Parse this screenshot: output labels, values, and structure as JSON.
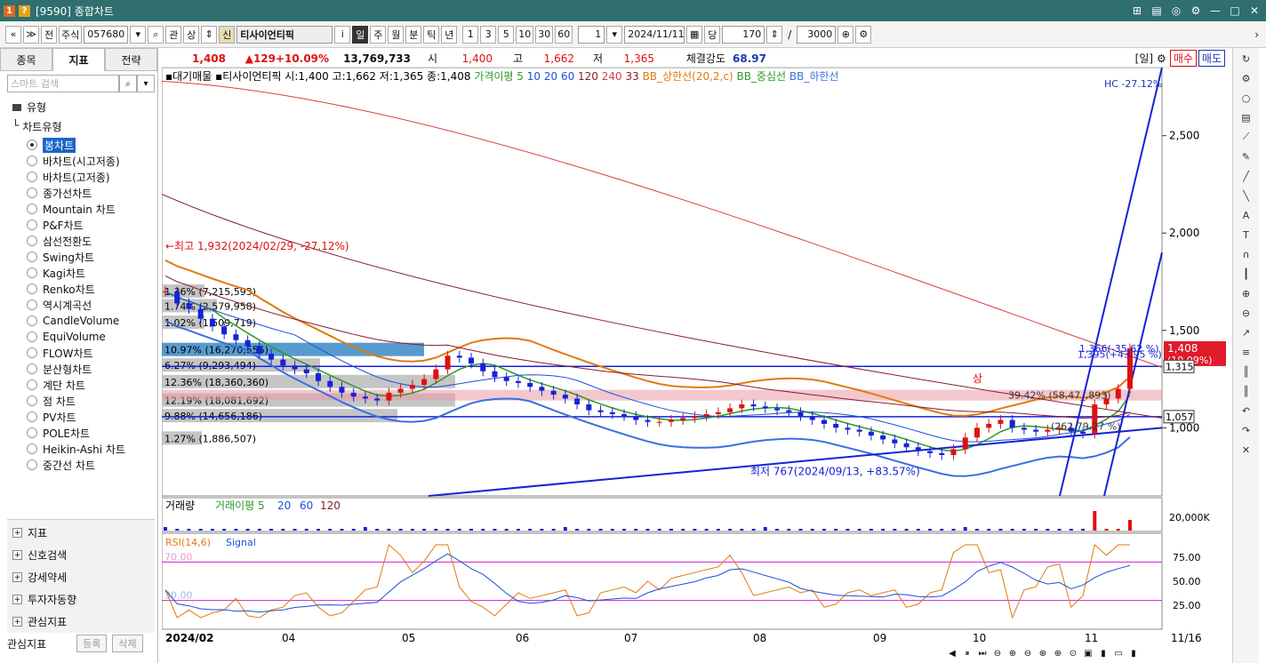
{
  "window": {
    "title": "[9590] 종합차트",
    "icon_label": "1",
    "icon_label2": "?"
  },
  "toolbar": {
    "nav_prev": "«",
    "nav_down": "»",
    "jeon": "전",
    "market": "주식",
    "code": "057680",
    "gwan": "관",
    "sang": "상",
    "sin": "신",
    "stock_name": "티사이언티픽",
    "i": "i",
    "periods": [
      "일",
      "주",
      "월",
      "분",
      "틱",
      "년"
    ],
    "selected_period": "일",
    "minutes": [
      "1",
      "3",
      "5",
      "10",
      "30",
      "60"
    ],
    "interval": "1",
    "date": "2024/11/11",
    "dang": "당",
    "count": "170",
    "slash": "/",
    "max": "3000"
  },
  "left": {
    "tabs": [
      "종목",
      "지표",
      "전략"
    ],
    "active_tab": "지표",
    "search_placeholder": "스마트 검색",
    "group": "유형",
    "category": "차트유형",
    "items": [
      "봉차트",
      "바차트(시고저종)",
      "바차트(고저종)",
      "종가선차트",
      "Mountain 차트",
      "P&F차트",
      "삼선전환도",
      "Swing차트",
      "Kagi차트",
      "Renko차트",
      "역시계곡선",
      "CandleVolume",
      "EquiVolume",
      "FLOW차트",
      "분산형차트",
      "계단 차트",
      "점 차트",
      "PV차트",
      "POLE차트",
      "Heikin-Ashi 차트",
      "중간선 차트"
    ],
    "selected_item": "봉차트",
    "sections": [
      "지표",
      "신호검색",
      "강세약세",
      "투자자동향",
      "관심지표"
    ],
    "fav_label": "관심지표",
    "reg": "등록",
    "del": "삭제"
  },
  "info": {
    "price": "1,408",
    "change": "▲129",
    "rate": "+10.09%",
    "volume": "13,769,733",
    "open_label": "시",
    "open": "1,400",
    "high_label": "고",
    "high": "1,662",
    "low_label": "저",
    "low": "1,365",
    "strength_label": "체결강도",
    "strength": "68.97",
    "period_tag": "[일]",
    "buy": "매수",
    "sell": "매도"
  },
  "legend": {
    "prefix": "▪대기매물 ▪티사이언티픽 시:1,400 고:1,662 저:1,365 종:1,408",
    "ma_label": "가격이평 5",
    "ma_vals": [
      {
        "t": "10",
        "c": "#1e4fd8"
      },
      {
        "t": "20",
        "c": "#1e4fd8"
      },
      {
        "t": "60",
        "c": "#1e4fd8"
      },
      {
        "t": "120",
        "c": "#8a1b2a"
      },
      {
        "t": "240",
        "c": "#d84040"
      },
      {
        "t": "33",
        "c": "#8a1b2a"
      }
    ],
    "bb_upper": "BB_상한선(20,2,c)",
    "bb_mid": "BB_중심선",
    "bb_low": "BB_하한선"
  },
  "price_axis": {
    "ticks": [
      "2,500",
      "2,000",
      "1,500",
      "1,000"
    ],
    "current": "1,408",
    "current_sub": "(10.09%)",
    "line1": "1,315",
    "line2": "1,057",
    "top_label": "HC -27.12%"
  },
  "annotations": {
    "high": "←최고 1,932(2024/02/29, -27.12%)",
    "low": "최저 767(2024/09/13, +83.57%)",
    "up_a": "1,366(-35.62 %)",
    "up_b": "1,395(+43.95 %)",
    "pct_a": "39.42% (58,47_,893)",
    "pct_b": "+99.56 %",
    "pct_c": "(262,79.27 %)",
    "sang": "상",
    "low2": "863(+2 %)"
  },
  "volume_profile": [
    {
      "label": "1.36% (7,215,593)"
    },
    {
      "label": "1.74% (2,579,958)"
    },
    {
      "label": "1.02% (1,509,719)"
    },
    {
      "label": "10.97% (16,270,555)"
    },
    {
      "label": "6.27% (9,293,494)"
    },
    {
      "label": "12.36% (18,360,360)"
    },
    {
      "label": "12.19% (18,081,692)"
    },
    {
      "label": "9.88% (14,656,186)"
    },
    {
      "label": "1.27% (1,886,507)"
    }
  ],
  "volume_panel": {
    "title": "거래량",
    "ma": "거래이평 5",
    "ma2": "20",
    "ma3": "60",
    "ma4": "120",
    "tick": "20,000K"
  },
  "rsi_panel": {
    "title": "RSI(14,6)",
    "signal": "Signal",
    "ticks": [
      "75.00",
      "50.00",
      "25.00"
    ],
    "lv70": "70.00",
    "lv30": "30.00"
  },
  "dates": [
    "2024/02",
    "04",
    "05",
    "06",
    "07",
    "08",
    "09",
    "10",
    "11",
    "11/16"
  ],
  "status": {
    "btns": [
      "◀",
      "⏸",
      "⏭",
      "⊖",
      "⊕",
      "⊖",
      "⊕",
      "⊕",
      "⊙",
      "▣",
      "▮",
      "▭",
      "▮"
    ]
  },
  "chart_data": {
    "type": "candlestick",
    "title": "티사이언티픽 (057680) 일봉",
    "x_range": [
      "2024/02",
      "2024/11/16"
    ],
    "ylim": [
      650,
      2850
    ],
    "last": {
      "date": "2024/11/11",
      "open": 1400,
      "high": 1662,
      "low": 1365,
      "close": 1408,
      "change": 129,
      "rate": 10.09,
      "volume": 13769733
    },
    "highest": {
      "value": 1932,
      "date": "2024/02/29"
    },
    "lowest": {
      "value": 767,
      "date": "2024/09/13"
    },
    "hlines": [
      1315,
      1057
    ],
    "close_series": [
      1700,
      1640,
      1610,
      1560,
      1520,
      1480,
      1450,
      1420,
      1380,
      1350,
      1320,
      1300,
      1280,
      1240,
      1210,
      1180,
      1160,
      1150,
      1140,
      1180,
      1200,
      1220,
      1250,
      1300,
      1370,
      1360,
      1330,
      1290,
      1260,
      1240,
      1230,
      1210,
      1190,
      1170,
      1150,
      1120,
      1090,
      1080,
      1070,
      1060,
      1040,
      1030,
      1030,
      1040,
      1050,
      1060,
      1070,
      1080,
      1100,
      1120,
      1110,
      1100,
      1090,
      1080,
      1060,
      1040,
      1020,
      1000,
      990,
      980,
      960,
      940,
      920,
      900,
      880,
      870,
      860,
      890,
      950,
      1000,
      1020,
      1040,
      1000,
      990,
      980,
      990,
      1000,
      980,
      970,
      1120,
      1150,
      1200,
      1408
    ]
  }
}
